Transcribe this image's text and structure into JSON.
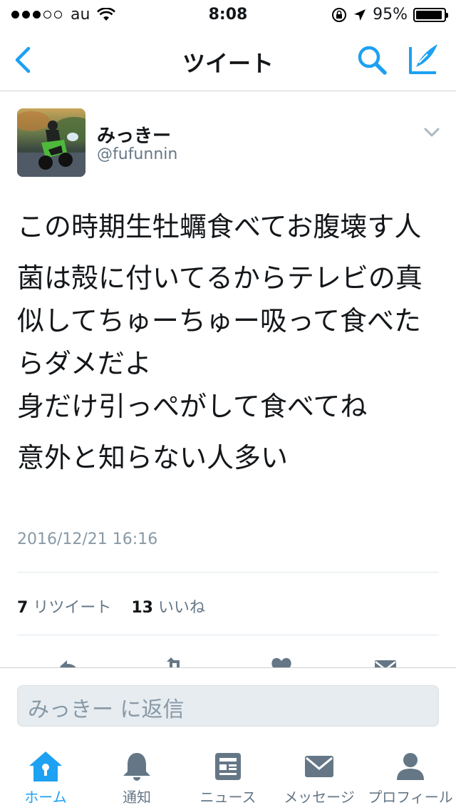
{
  "status_bar": {
    "carrier": "au",
    "time": "8:08",
    "battery_percent": "95%",
    "battery_level": 0.95,
    "signal_dots_filled": 3,
    "signal_dots_total": 5
  },
  "navbar": {
    "title": "ツイート",
    "back_icon": "chevron-left-icon",
    "search_icon": "search-icon",
    "compose_icon": "compose-icon"
  },
  "tweet": {
    "user_name": "みっきー",
    "handle": "@fufunnin",
    "paragraphs": [
      "この時期生牡蠣食べてお腹壊す人",
      "菌は殻に付いてるからテレビの真似してちゅーちゅー吸って食べたらダメだよ\n身だけ引っぺがして食べてね",
      "意外と知らない人多い"
    ],
    "timestamp": "2016/12/21 16:16",
    "retweet_count": "7",
    "retweet_label": "リツイート",
    "like_count": "13",
    "like_label": "いいね"
  },
  "reply": {
    "placeholder": "みっきー に返信"
  },
  "tabbar": {
    "items": [
      {
        "label": "ホーム",
        "icon": "home-icon",
        "active": true
      },
      {
        "label": "通知",
        "icon": "bell-icon",
        "active": false
      },
      {
        "label": "ニュース",
        "icon": "news-icon",
        "active": false
      },
      {
        "label": "メッセージ",
        "icon": "mail-icon",
        "active": false
      },
      {
        "label": "プロフィール",
        "icon": "person-icon",
        "active": false
      }
    ]
  },
  "colors": {
    "accent": "#1da1f2",
    "text": "#14171a",
    "secondary": "#657786"
  }
}
